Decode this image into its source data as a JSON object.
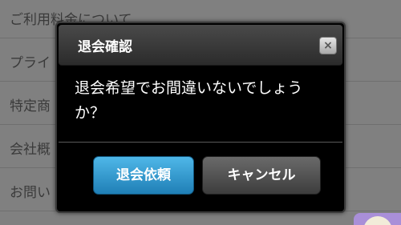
{
  "background_list": {
    "items": [
      {
        "label": "ご利用料金について"
      },
      {
        "label": "プライ"
      },
      {
        "label": "特定商"
      },
      {
        "label": "会社概"
      },
      {
        "label": "お問い"
      }
    ]
  },
  "dialog": {
    "title": "退会確認",
    "close_icon": "×",
    "message": "退会希望でお間違いないでしょうか？",
    "primary_button": "退会依頼",
    "secondary_button": "キャンセル"
  },
  "colors": {
    "primary_button": "#2a94cc",
    "dialog_background": "#000000",
    "overlay": "#808080"
  }
}
